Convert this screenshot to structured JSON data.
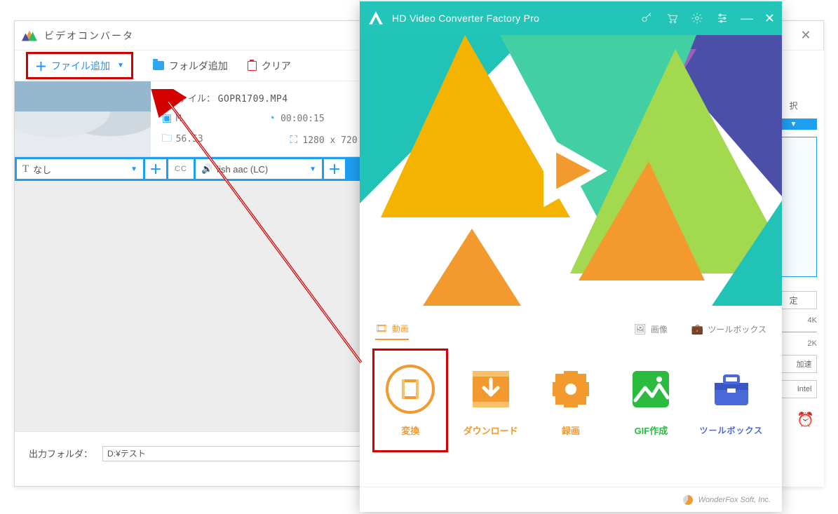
{
  "converter": {
    "title": "ビデオコンバータ",
    "toolbar": {
      "add_file": "ファイル追加",
      "add_folder": "フォルダ追加",
      "clear": "クリア"
    },
    "file": {
      "source_label": "元ファイル：",
      "source_name": "GOPR1709.MP4",
      "codec": "M",
      "duration": "00:00:15",
      "size": "56.53",
      "resolution": "1280 x 720"
    },
    "tracks": {
      "subtitle_option": "なし",
      "audio_option": "lish aac (LC)"
    },
    "output": {
      "label": "出力フォルダ：",
      "path": "D:¥テスト"
    }
  },
  "right_panel": {
    "pick_label": "択",
    "setting": "定",
    "res_4k": "4K",
    "res_2k": "2K",
    "accel": "加速",
    "intel": "Intel"
  },
  "hd": {
    "title": "HD Video Converter Factory Pro",
    "categories": {
      "video": "動画",
      "image": "画像",
      "toolbox": "ツールボックス"
    },
    "cards": {
      "convert": "変換",
      "download": "ダウンロード",
      "record": "録画",
      "gif": "GIF作成",
      "toolbox": "ツールボックス"
    },
    "footer": "WonderFox Soft, Inc."
  }
}
